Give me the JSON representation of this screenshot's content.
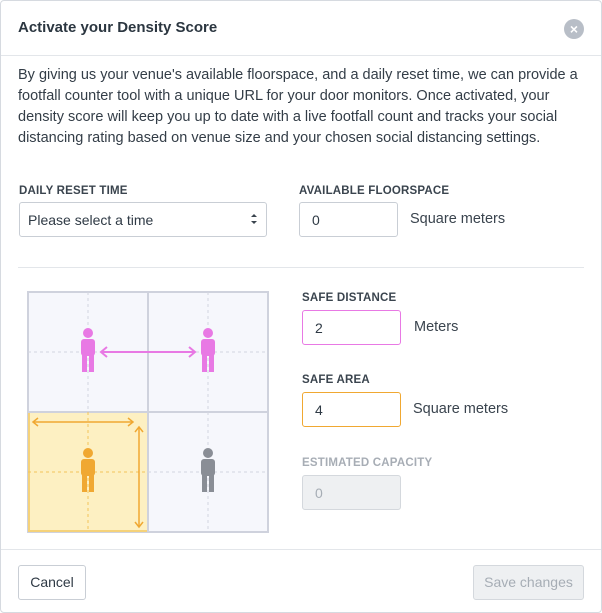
{
  "modal": {
    "title": "Activate your Density Score",
    "close_icon": "close-icon"
  },
  "intro": "By giving us your venue's available floorspace, and a daily reset time, we can provide a footfall counter tool with a unique URL for your door monitors. Once activated, your density score will keep you up to date with a live footfall count and tracks your social distancing rating based on venue size and your chosen social distancing settings.",
  "reset_time": {
    "label": "DAILY RESET TIME",
    "selected": "Please select a time"
  },
  "floorspace": {
    "label": "AVAILABLE FLOORSPACE",
    "value": "0",
    "unit": "Square meters"
  },
  "safe_distance": {
    "label": "SAFE DISTANCE",
    "value": "2",
    "unit": "Meters"
  },
  "safe_area": {
    "label": "SAFE AREA",
    "value": "4",
    "unit": "Square meters"
  },
  "estimated_capacity": {
    "label": "ESTIMATED CAPACITY",
    "value": "0"
  },
  "footer": {
    "cancel_label": "Cancel",
    "save_label": "Save changes"
  },
  "colors": {
    "distance_accent": "#e879e4",
    "area_accent": "#f0a832",
    "area_fill": "#fdf0c2",
    "grid_line": "#cfd2dd",
    "grid_fill": "#f6f7fc",
    "person_gray": "#8a8e96"
  }
}
